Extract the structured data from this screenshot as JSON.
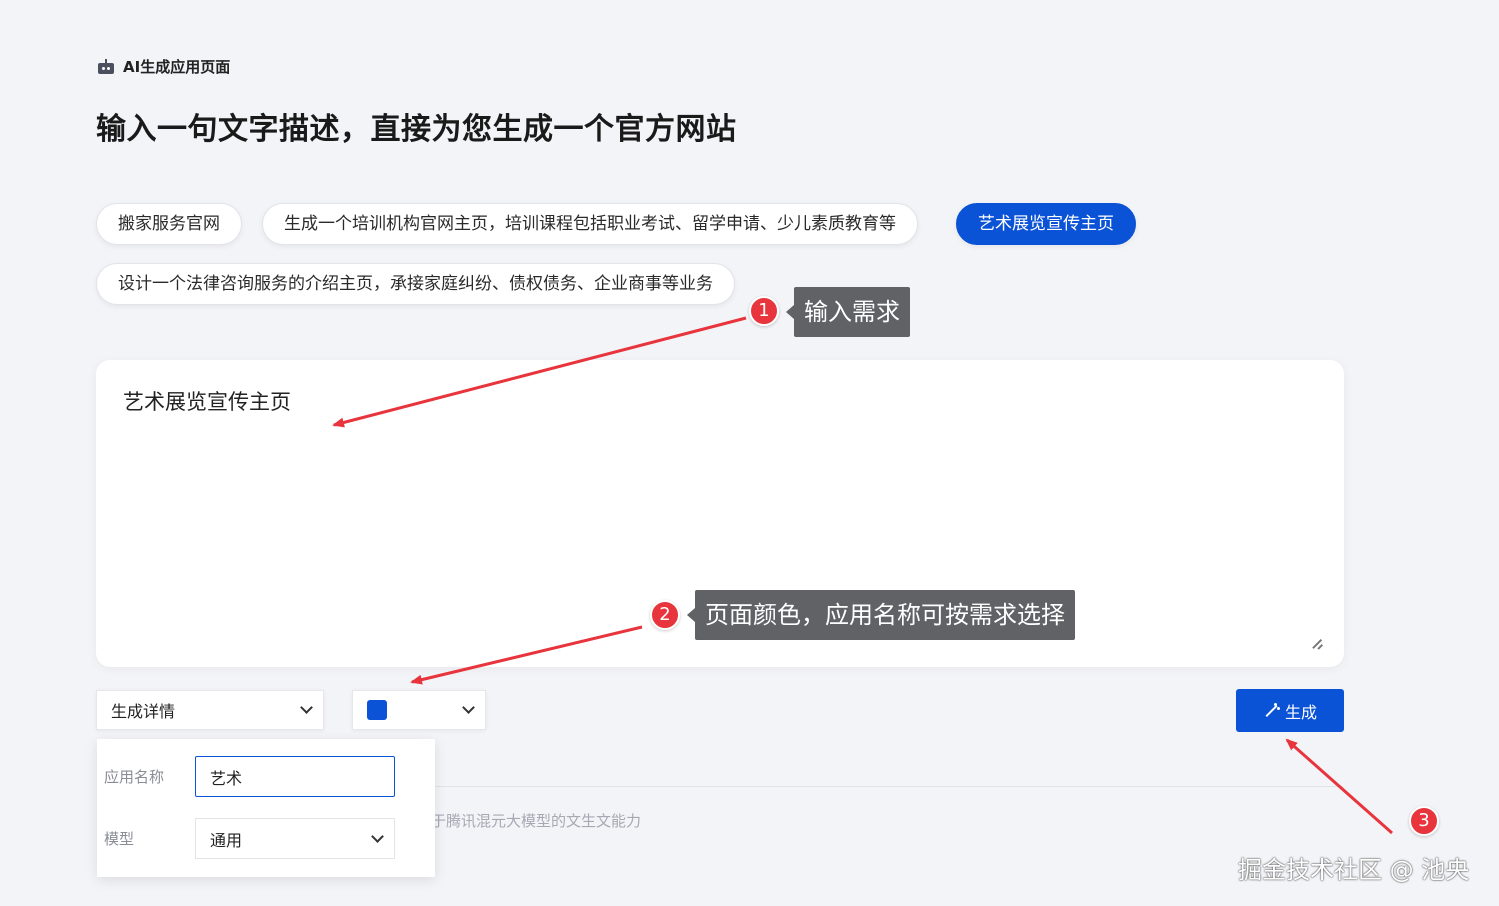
{
  "header": {
    "app_label": "AI生成应用页面",
    "title": "输入一句文字描述，直接为您生成一个官方网站"
  },
  "chips": [
    {
      "label": "搬家服务官网",
      "active": false
    },
    {
      "label": "生成一个培训机构官网主页，培训课程包括职业考试、留学申请、少儿素质教育等",
      "active": false
    },
    {
      "label": "艺术展览宣传主页",
      "active": true
    },
    {
      "label": "设计一个法律咨询服务的介绍主页，承接家庭纠纷、债权债务、企业商事等业务",
      "active": false
    }
  ],
  "prompt": {
    "value": "艺术展览宣传主页"
  },
  "controls": {
    "details_select": "生成详情",
    "color_value": "#0a52d6",
    "generate_label": "生成"
  },
  "panel": {
    "app_name_label": "应用名称",
    "app_name_value": "艺术",
    "model_label": "模型",
    "model_value": "通用"
  },
  "footer_note": "于腾讯混元大模型的文生文能力",
  "annotations": {
    "step1_num": "1",
    "step1_text": "输入需求",
    "step2_num": "2",
    "step2_text": "页面颜色，应用名称可按需求选择",
    "step3_num": "3",
    "arrow_color": "#e8343c"
  },
  "watermark": "掘金技术社区 @ 池央"
}
